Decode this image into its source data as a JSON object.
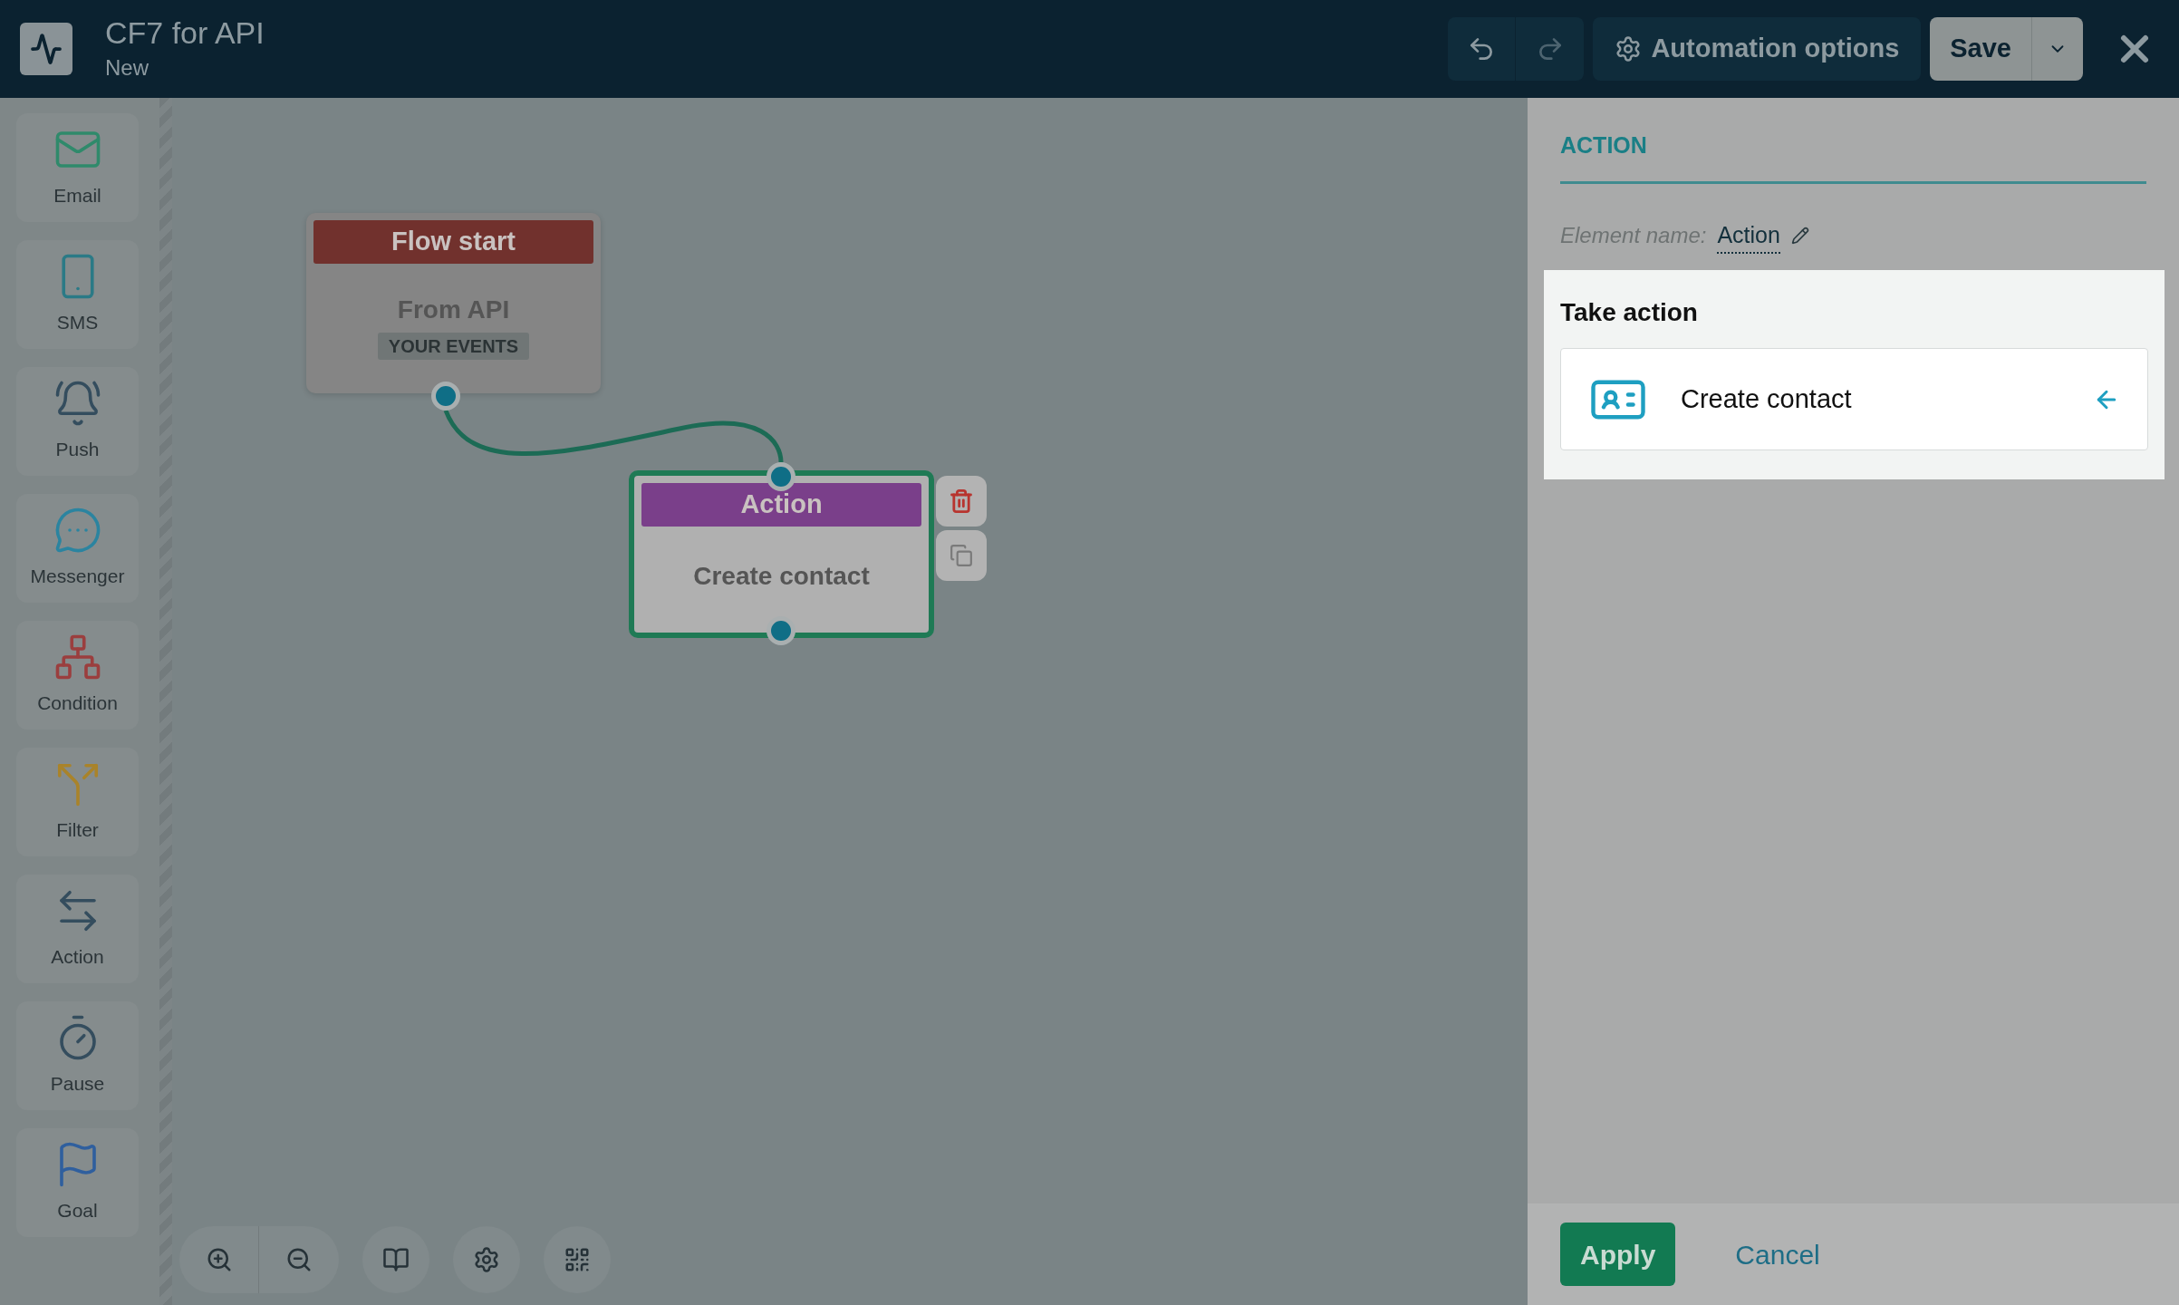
{
  "header": {
    "title": "CF7 for API",
    "subtitle": "New",
    "options_button": "Automation options",
    "save_button": "Save"
  },
  "palette": [
    {
      "label": "Email",
      "kind": "email"
    },
    {
      "label": "SMS",
      "kind": "sms"
    },
    {
      "label": "Push",
      "kind": "push"
    },
    {
      "label": "Messenger",
      "kind": "messenger"
    },
    {
      "label": "Condition",
      "kind": "condition"
    },
    {
      "label": "Filter",
      "kind": "filter"
    },
    {
      "label": "Action",
      "kind": "action"
    },
    {
      "label": "Pause",
      "kind": "pause"
    },
    {
      "label": "Goal",
      "kind": "goal"
    }
  ],
  "nodes": [
    {
      "kind": "start",
      "header": "Flow start",
      "body": "From API",
      "tag": "YOUR EVENTS",
      "selected": false
    },
    {
      "kind": "action",
      "header": "Action",
      "body": "Create contact",
      "selected": true
    }
  ],
  "panel": {
    "title": "ACTION",
    "name_label": "Element name:",
    "name_value": "Action",
    "section_title": "Take action",
    "choice": "Create contact",
    "apply": "Apply",
    "cancel": "Cancel"
  }
}
